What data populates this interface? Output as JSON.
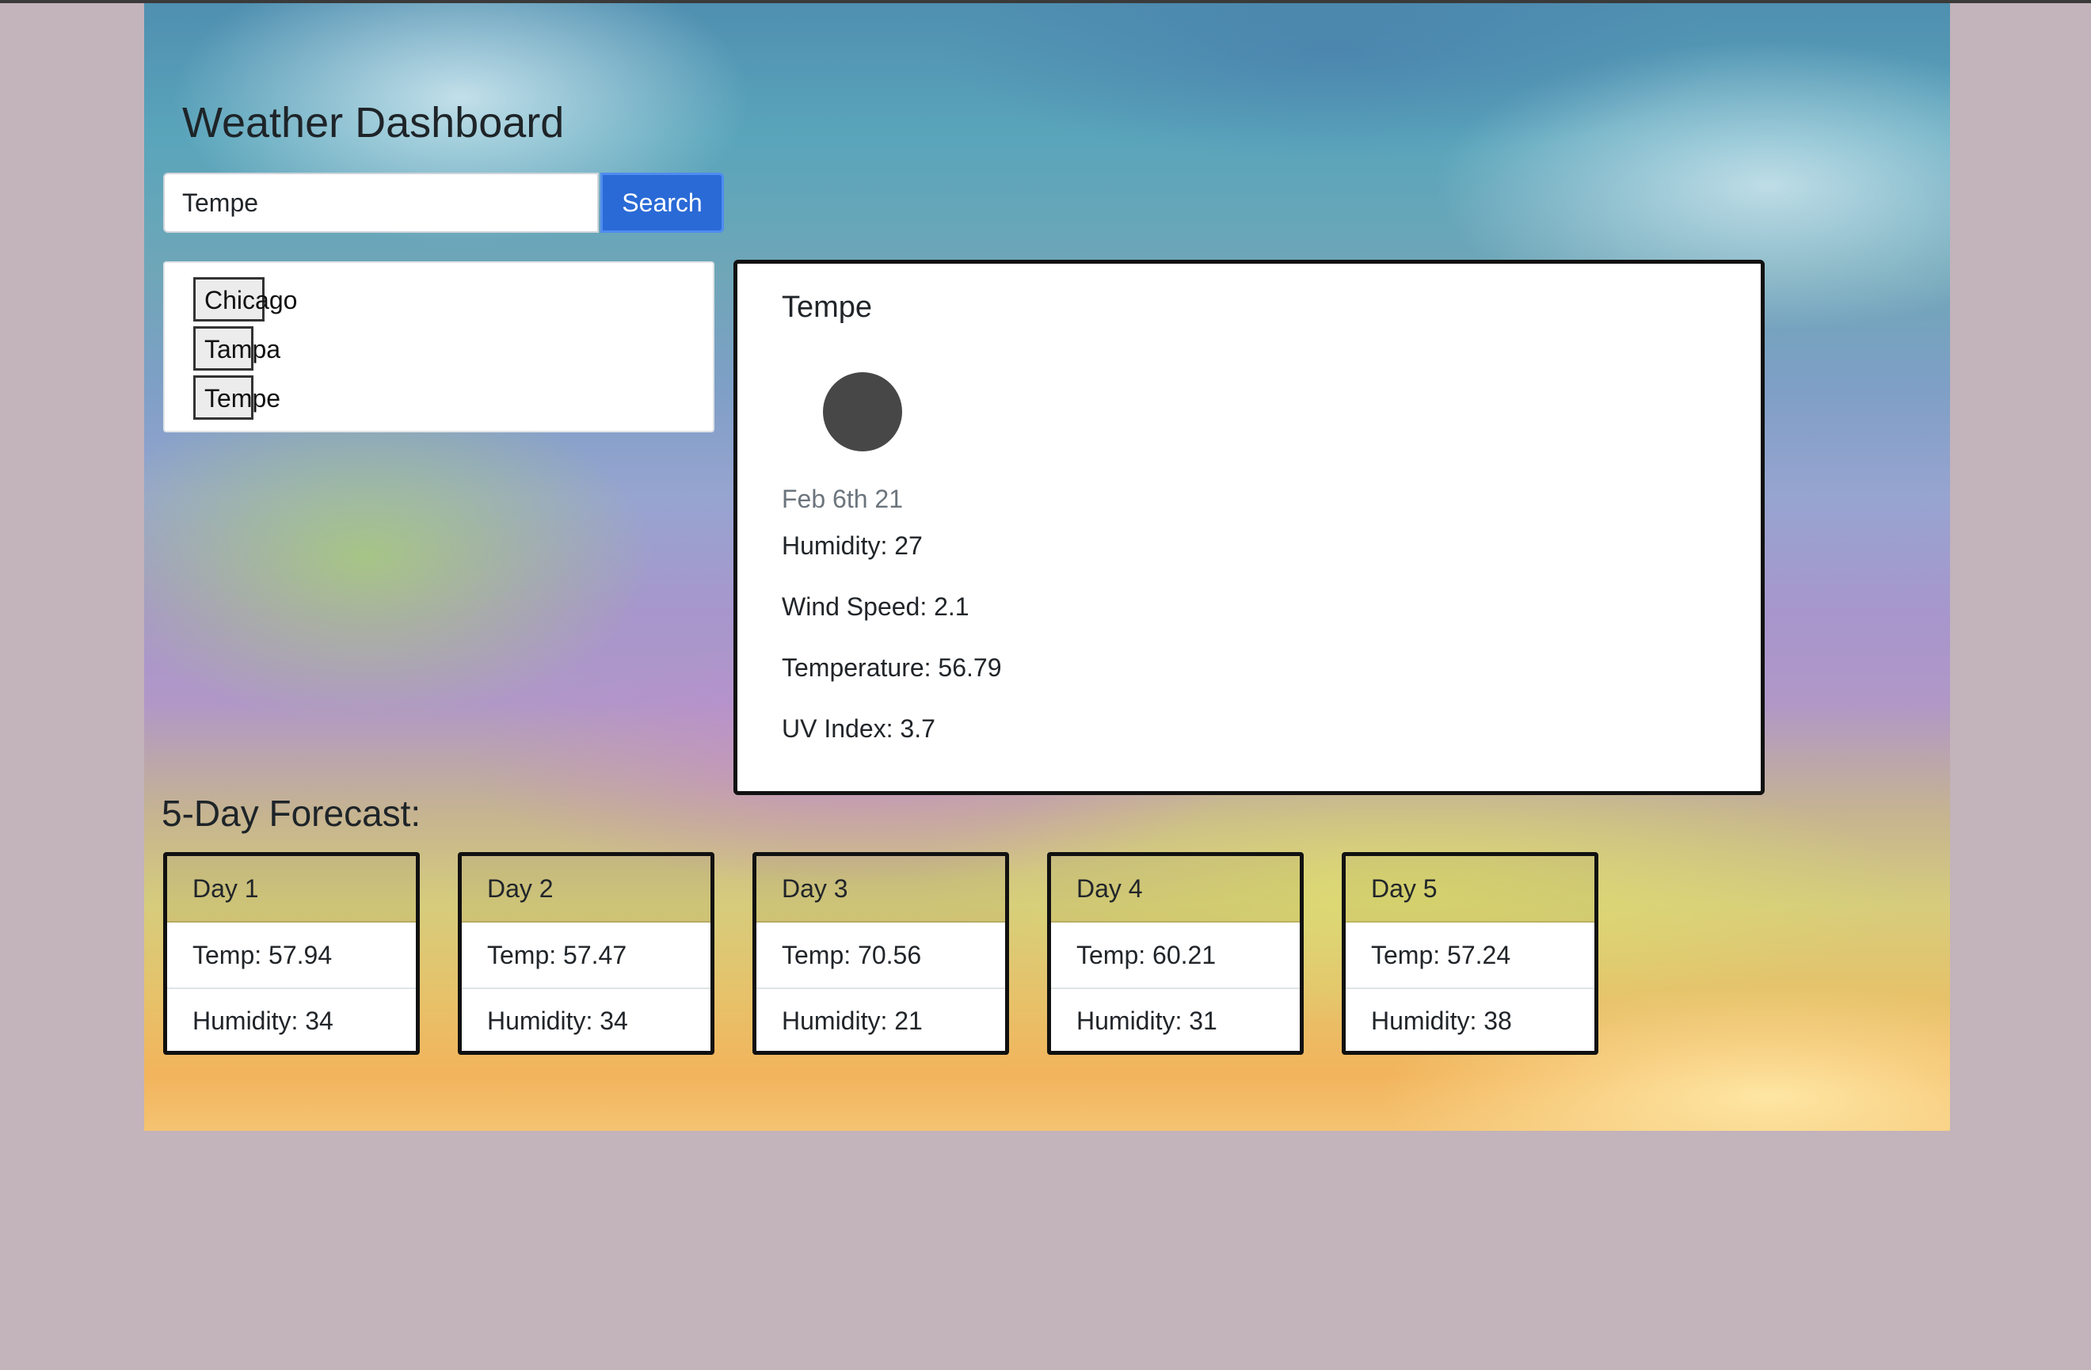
{
  "app": {
    "title": "Weather Dashboard"
  },
  "search": {
    "value": "Tempe",
    "button_label": "Search"
  },
  "history": [
    "Chicago",
    "Tampa",
    "Tempe"
  ],
  "current": {
    "city": "Tempe",
    "icon": "weather-icon",
    "date": "Feb 6th 21",
    "humidity": "Humidity: 27",
    "wind_speed": "Wind Speed: 2.1",
    "temperature": "Temperature: 56.79",
    "uv_index": "UV Index: 3.7"
  },
  "forecast": {
    "title": "5-Day Forecast:",
    "days": [
      {
        "label": "Day 1",
        "temp": "Temp: 57.94",
        "humidity": "Humidity: 34"
      },
      {
        "label": "Day 2",
        "temp": "Temp: 57.47",
        "humidity": "Humidity: 34"
      },
      {
        "label": "Day 3",
        "temp": "Temp: 70.56",
        "humidity": "Humidity: 21"
      },
      {
        "label": "Day 4",
        "temp": "Temp: 60.21",
        "humidity": "Humidity: 31"
      },
      {
        "label": "Day 5",
        "temp": "Temp: 57.24",
        "humidity": "Humidity: 38"
      }
    ]
  },
  "colors": {
    "page_background": "#c3b3ba",
    "search_button": "#2a6ad6",
    "card_border": "#111111",
    "date_text": "#6c757d"
  }
}
